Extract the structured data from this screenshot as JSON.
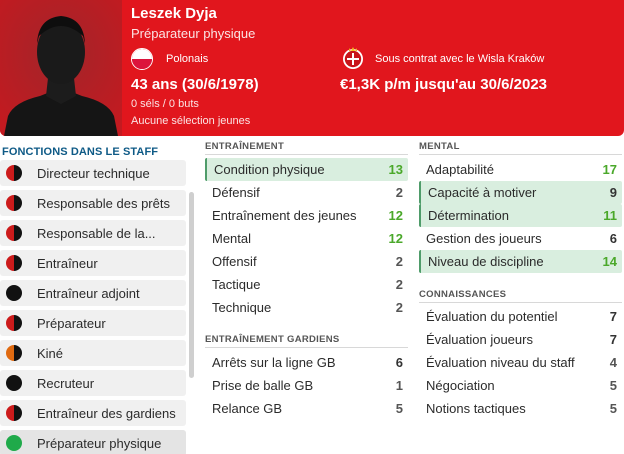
{
  "profile": {
    "name": "Leszek Dyja",
    "role": "Préparateur physique",
    "nationality": "Polonais",
    "age": "43 ans (30/6/1978)",
    "caps": "0 séls / 0 buts",
    "youth": "Aucune sélection jeunes",
    "contract": "Sous contrat avec le Wisla Kraków",
    "wage": "€1,3K p/m jusqu'au 30/6/2023"
  },
  "staff_roles": {
    "title": "FONCTIONS DANS LE STAFF",
    "items": [
      {
        "label": "Directeur technique",
        "icon": "role-suitability-icon",
        "colors": [
          "#cc1b1b",
          "#111111"
        ]
      },
      {
        "label": "Responsable des prêts",
        "icon": "role-suitability-icon",
        "colors": [
          "#cc1b1b",
          "#111111"
        ]
      },
      {
        "label": "Responsable de la...",
        "icon": "role-suitability-icon",
        "colors": [
          "#cc1b1b",
          "#111111"
        ]
      },
      {
        "label": "Entraîneur",
        "icon": "role-suitability-icon",
        "colors": [
          "#cc1b1b",
          "#111111"
        ]
      },
      {
        "label": "Entraîneur adjoint",
        "icon": "role-suitability-icon",
        "colors": [
          "#111111",
          "#111111"
        ]
      },
      {
        "label": "Préparateur",
        "icon": "role-suitability-icon",
        "colors": [
          "#cc1b1b",
          "#111111"
        ]
      },
      {
        "label": "Kiné",
        "icon": "role-suitability-icon",
        "colors": [
          "#e06a10",
          "#111111"
        ]
      },
      {
        "label": "Recruteur",
        "icon": "role-suitability-icon",
        "colors": [
          "#111111",
          "#111111"
        ]
      },
      {
        "label": "Entraîneur des gardiens",
        "icon": "role-suitability-icon",
        "colors": [
          "#cc1b1b",
          "#111111"
        ]
      },
      {
        "label": "Préparateur physique",
        "icon": "role-suitability-icon",
        "colors": [
          "#1faa4a",
          "#1faa4a"
        ]
      }
    ]
  },
  "training": {
    "title": "ENTRAÎNEMENT",
    "items": [
      {
        "label": "Condition physique",
        "value": "13",
        "highlight": true,
        "color": "green"
      },
      {
        "label": "Défensif",
        "value": "2"
      },
      {
        "label": "Entraînement des jeunes",
        "value": "12",
        "color": "green"
      },
      {
        "label": "Mental",
        "value": "12",
        "color": "green"
      },
      {
        "label": "Offensif",
        "value": "2"
      },
      {
        "label": "Tactique",
        "value": "2"
      },
      {
        "label": "Technique",
        "value": "2"
      }
    ]
  },
  "goalkeeping": {
    "title": "ENTRAÎNEMENT GARDIENS",
    "items": [
      {
        "label": "Arrêts sur la ligne GB",
        "value": "6",
        "color": "dark"
      },
      {
        "label": "Prise de balle GB",
        "value": "1"
      },
      {
        "label": "Relance GB",
        "value": "5"
      }
    ]
  },
  "mental": {
    "title": "MENTAL",
    "items": [
      {
        "label": "Adaptabilité",
        "value": "17",
        "color": "green"
      },
      {
        "label": "Capacité à motiver",
        "value": "9",
        "highlight": true,
        "color": "dark"
      },
      {
        "label": "Détermination",
        "value": "11",
        "highlight": true,
        "color": "green"
      },
      {
        "label": "Gestion des joueurs",
        "value": "6",
        "color": "dark"
      },
      {
        "label": "Niveau de discipline",
        "value": "14",
        "highlight": true,
        "color": "green"
      }
    ]
  },
  "knowledge": {
    "title": "CONNAISSANCES",
    "items": [
      {
        "label": "Évaluation du potentiel",
        "value": "7",
        "color": "dark"
      },
      {
        "label": "Évaluation joueurs",
        "value": "7",
        "color": "dark"
      },
      {
        "label": "Évaluation niveau du staff",
        "value": "4"
      },
      {
        "label": "Négociation",
        "value": "5"
      },
      {
        "label": "Notions tactiques",
        "value": "5"
      }
    ]
  },
  "colors": {
    "header_red": "#e1161d",
    "highlight_bg": "#d9eedf",
    "green_value": "#4aa82a",
    "section_blue": "#0e5a86"
  }
}
